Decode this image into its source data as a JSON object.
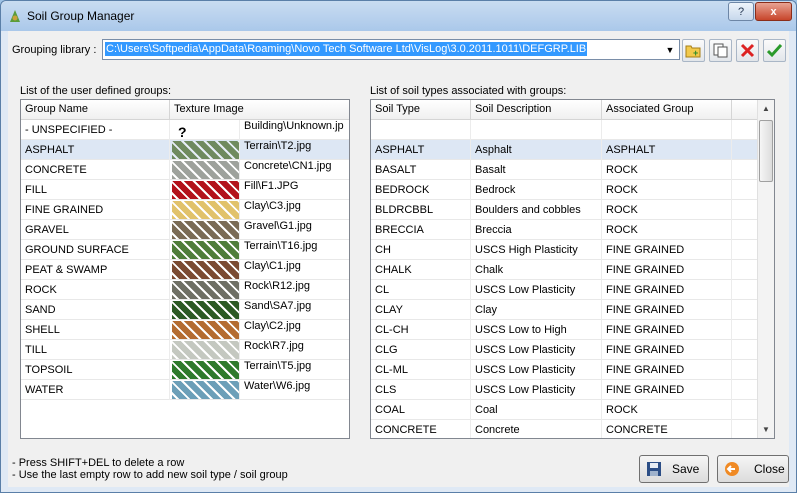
{
  "window": {
    "title": "Soil Group Manager",
    "help_label": "?",
    "close_label": "x"
  },
  "grouping": {
    "label": "Grouping library :",
    "value": "C:\\Users\\Softpedia\\AppData\\Roaming\\Novo Tech Software Ltd\\VisLog\\3.0.2011.1011\\DEFGRP.LIB"
  },
  "toolbar": {
    "icons": [
      "open-folder-icon",
      "copy-icon",
      "delete-icon",
      "check-icon"
    ]
  },
  "groups": {
    "caption": "List of the user defined groups:",
    "columns": [
      "Group Name",
      "Texture Image"
    ],
    "rows": [
      {
        "name": "- UNSPECIFIED -",
        "texture": "Building\\Unknown.jp",
        "color": "#ffffff",
        "glyph": "?"
      },
      {
        "name": "ASPHALT",
        "texture": "Terrain\\T2.jpg",
        "color": "#6f8a5f",
        "glyph": ""
      },
      {
        "name": "CONCRETE",
        "texture": "Concrete\\CN1.jpg",
        "color": "#9ea29c",
        "glyph": ""
      },
      {
        "name": "FILL",
        "texture": "Fill\\F1.JPG",
        "color": "#b3121b",
        "glyph": ""
      },
      {
        "name": "FINE GRAINED",
        "texture": "Clay\\C3.jpg",
        "color": "#e1c26a",
        "glyph": ""
      },
      {
        "name": "GRAVEL",
        "texture": "Gravel\\G1.jpg",
        "color": "#7a6b55",
        "glyph": ""
      },
      {
        "name": "GROUND SURFACE",
        "texture": "Terrain\\T16.jpg",
        "color": "#4f7d3a",
        "glyph": ""
      },
      {
        "name": "PEAT & SWAMP",
        "texture": "Clay\\C1.jpg",
        "color": "#7b4b32",
        "glyph": ""
      },
      {
        "name": "ROCK",
        "texture": "Rock\\R12.jpg",
        "color": "#6e6f64",
        "glyph": ""
      },
      {
        "name": "SAND",
        "texture": "Sand\\SA7.jpg",
        "color": "#2c5a24",
        "glyph": ""
      },
      {
        "name": "SHELL",
        "texture": "Clay\\C2.jpg",
        "color": "#b46c31",
        "glyph": ""
      },
      {
        "name": "TILL",
        "texture": "Rock\\R7.jpg",
        "color": "#c4c8c0",
        "glyph": ""
      },
      {
        "name": "TOPSOIL",
        "texture": "Terrain\\T5.jpg",
        "color": "#2e7a2c",
        "glyph": ""
      },
      {
        "name": "WATER",
        "texture": "Water\\W6.jpg",
        "color": "#6c9fb8",
        "glyph": ""
      }
    ]
  },
  "soils": {
    "caption": "List of soil types associated with groups:",
    "columns": [
      "Soil Type",
      "Soil Description",
      "Associated Group"
    ],
    "rows": [
      [
        "",
        "",
        ""
      ],
      [
        "ASPHALT",
        "Asphalt",
        "ASPHALT"
      ],
      [
        "BASALT",
        "Basalt",
        "ROCK"
      ],
      [
        "BEDROCK",
        "Bedrock",
        "ROCK"
      ],
      [
        "BLDRCBBL",
        "Boulders and cobbles",
        "ROCK"
      ],
      [
        "BRECCIA",
        "Breccia",
        "ROCK"
      ],
      [
        "CH",
        "USCS High Plasticity",
        "FINE GRAINED"
      ],
      [
        "CHALK",
        "Chalk",
        "FINE GRAINED"
      ],
      [
        "CL",
        "USCS Low Plasticity",
        "FINE GRAINED"
      ],
      [
        "CLAY",
        "Clay",
        "FINE GRAINED"
      ],
      [
        "CL-CH",
        "USCS Low to High",
        "FINE GRAINED"
      ],
      [
        "CLG",
        "USCS Low Plasticity",
        "FINE GRAINED"
      ],
      [
        "CL-ML",
        "USCS Low Plasticity",
        "FINE GRAINED"
      ],
      [
        "CLS",
        "USCS Low Plasticity",
        "FINE GRAINED"
      ],
      [
        "COAL",
        "Coal",
        "ROCK"
      ],
      [
        "CONCRETE",
        "Concrete",
        "CONCRETE"
      ]
    ]
  },
  "notes": [
    "- Press SHIFT+DEL to delete a row",
    "- Use the last empty row to add new soil type / soil group"
  ],
  "buttons": {
    "save": "Save",
    "close": "Close"
  },
  "colors": {
    "selection": "#dde7f4",
    "combo_highlight": "#3399ff"
  }
}
